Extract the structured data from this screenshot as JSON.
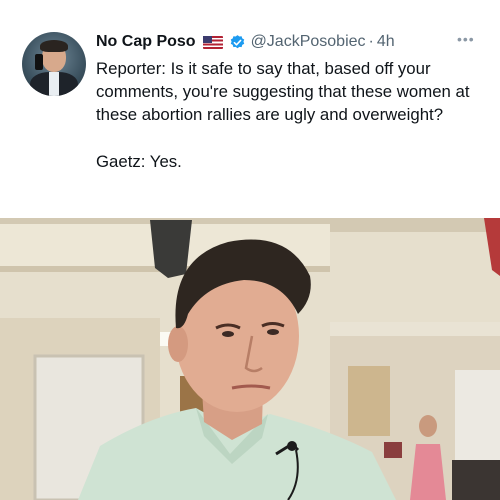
{
  "tweet": {
    "display_name": "No Cap Poso",
    "flag_icon": "us-flag-icon",
    "verified_icon": "verified-badge-icon",
    "verified_color": "#1d9bf0",
    "handle": "@JackPosobiec",
    "separator": "·",
    "timestamp": "4h",
    "more_icon": "more-horizontal-icon",
    "text_line_1": "Reporter: Is it safe to say that, based off your comments, you're suggesting that these women at these abortion rallies are ugly and overweight?",
    "text_line_2": "Gaetz: Yes."
  },
  "colors": {
    "text_primary": "#0f1419",
    "text_secondary": "#536471",
    "background": "#ffffff"
  }
}
